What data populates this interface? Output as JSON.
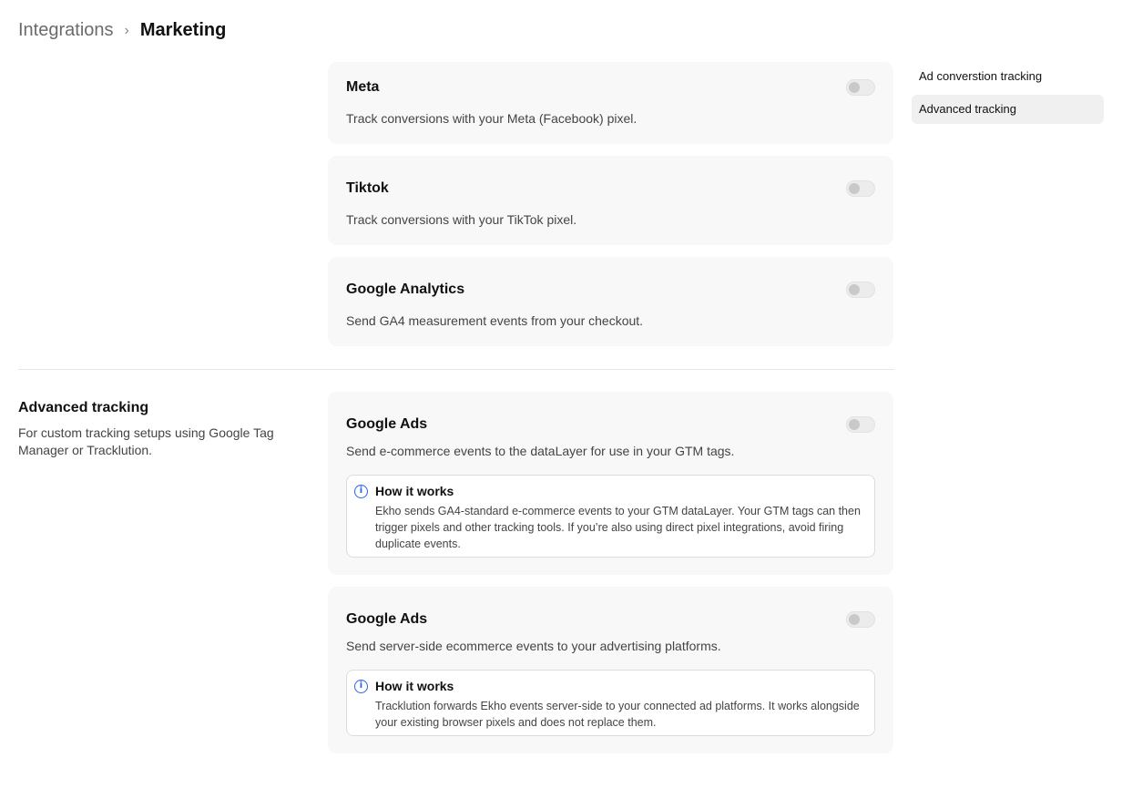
{
  "breadcrumb": {
    "root": "Integrations",
    "separator": "›",
    "current": "Marketing"
  },
  "side_nav": {
    "items": [
      {
        "label": "Ad converstion tracking",
        "active": false
      },
      {
        "label": "Advanced tracking",
        "active": true
      }
    ]
  },
  "ad_conversion": {
    "cards": [
      {
        "title": "Meta",
        "description": "Track conversions with your Meta (Facebook) pixel.",
        "enabled": false
      },
      {
        "title": "Tiktok",
        "description": "Track conversions with your TikTok pixel.",
        "enabled": false
      },
      {
        "title": "Google Analytics",
        "description": "Send GA4 measurement events from your checkout.",
        "enabled": false
      }
    ]
  },
  "advanced_tracking": {
    "title": "Advanced tracking",
    "description": "For custom tracking setups using Google Tag Manager or Tracklution.",
    "cards": [
      {
        "title": "Google Ads",
        "description": "Send e-commerce events to the dataLayer for use in your GTM tags.",
        "enabled": false,
        "info": {
          "title": "How it works",
          "body": "Ekho sends GA4-standard e-commerce events to your GTM dataLayer. Your GTM tags can then trigger pixels and other tracking tools. If you’re also using direct pixel integrations, avoid firing duplicate events."
        }
      },
      {
        "title": "Google Ads",
        "description": "Send server-side ecommerce events to your advertising platforms.",
        "enabled": false,
        "info": {
          "title": "How it works",
          "body": "Tracklution forwards Ekho events server-side to your connected ad platforms. It works alongside your existing browser pixels and does not replace them."
        }
      }
    ]
  },
  "icons": {
    "info": "info-circle-icon",
    "info_glyph": "i",
    "accent": "#2563eb"
  }
}
